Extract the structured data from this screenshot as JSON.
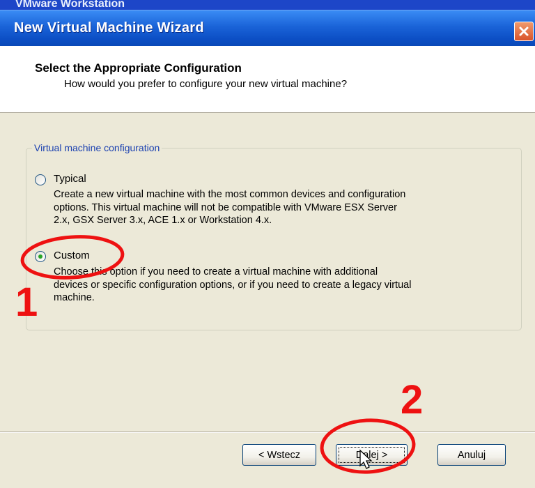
{
  "background_app_title": "VMware Workstation",
  "window": {
    "title": "New Virtual Machine Wizard",
    "close_icon": "close-icon"
  },
  "header": {
    "title": "Select the Appropriate Configuration",
    "subtitle": "How would you prefer to configure your new virtual machine?"
  },
  "config_group": {
    "legend": "Virtual machine configuration",
    "options": [
      {
        "label": "Typical",
        "selected": false,
        "description_lines": [
          "Create a new virtual machine with the most common devices and configuration",
          "options. This virtual machine will not be compatible with VMware ESX Server",
          "2.x, GSX Server 3.x, ACE 1.x or Workstation 4.x."
        ]
      },
      {
        "label": "Custom",
        "selected": true,
        "description_lines": [
          "Choose this option if you need to create a virtual machine with additional",
          "devices or specific configuration options, or if you need to create a legacy virtual",
          "machine."
        ]
      }
    ]
  },
  "buttons": {
    "back": "< Wstecz",
    "next": "Dalej >",
    "cancel": "Anuluj"
  },
  "annotations": {
    "marker_1": "1",
    "marker_2": "2",
    "color": "#ee1111"
  },
  "colors": {
    "titlebar": "#0c4fc5",
    "dialog_bg": "#ece9d8",
    "legend_text": "#1a40b0",
    "close_button": "#d9542b"
  }
}
